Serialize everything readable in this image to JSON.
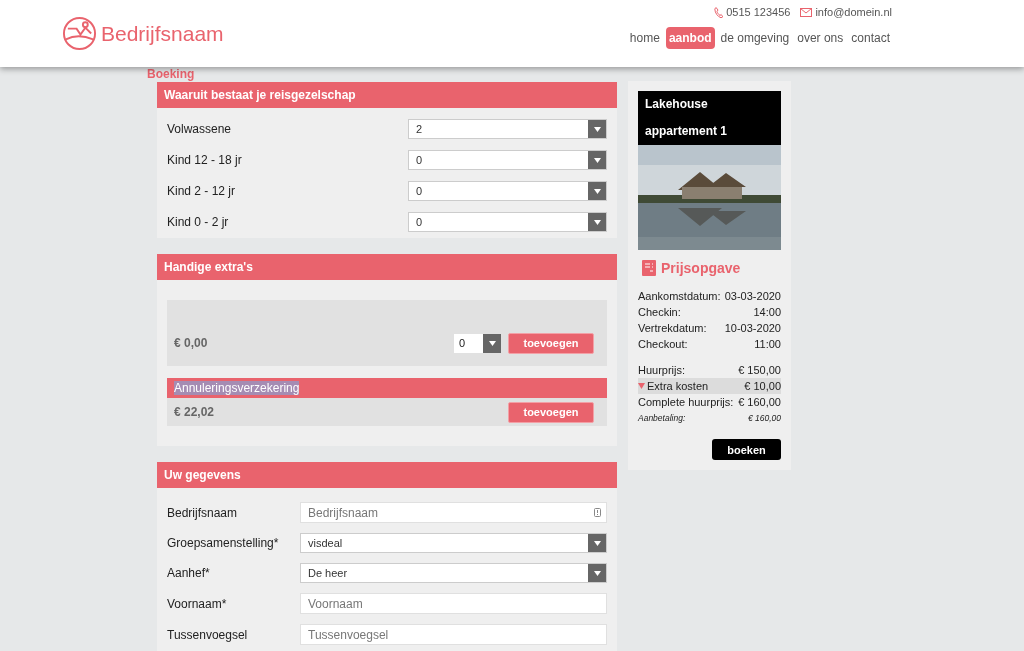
{
  "header": {
    "logo": "Bedrijfsnaam",
    "phone": "0515 123456",
    "email": "info@domein.nl",
    "nav": [
      {
        "label": "home",
        "selected": false
      },
      {
        "label": "aanbod",
        "selected": true
      },
      {
        "label": "de omgeving",
        "selected": false
      },
      {
        "label": "over ons",
        "selected": false
      },
      {
        "label": "contact",
        "selected": false
      }
    ]
  },
  "page_title": "Boeking",
  "party": {
    "title": "Waaruit bestaat je reisgezelschap",
    "rows": [
      {
        "label": "Volwassene",
        "value": "2"
      },
      {
        "label": "Kind 12 - 18 jr",
        "value": "0"
      },
      {
        "label": "Kind 2 - 12 jr",
        "value": "0"
      },
      {
        "label": "Kind 0 - 2 jr",
        "value": "0"
      }
    ]
  },
  "extras": {
    "title": "Handige extra's",
    "items": [
      {
        "kind": "quantity",
        "price": "€ 0,00",
        "quantity": "0",
        "button": "toevoegen"
      },
      {
        "kind": "simple",
        "title": "Annuleringsverzekering",
        "highlighted": true,
        "price": "€ 22,02",
        "button": "toevoegen"
      }
    ]
  },
  "details": {
    "title": "Uw gegevens",
    "fields": [
      {
        "kind": "text",
        "label": "Bedrijfsnaam",
        "placeholder": "Bedrijfsnaam"
      },
      {
        "kind": "select",
        "label": "Groepsamenstelling*",
        "value": "visdeal"
      },
      {
        "kind": "select",
        "label": "Aanhef*",
        "value": "De heer"
      },
      {
        "kind": "text",
        "label": "Voornaam*",
        "placeholder": "Voornaam"
      },
      {
        "kind": "text",
        "label": "Tussenvoegsel",
        "placeholder": "Tussenvoegsel"
      }
    ]
  },
  "quote": {
    "accommodation": "Lakehouse appartement 1",
    "title": "Prijsopgave",
    "details": [
      {
        "label": "Aankomstdatum:",
        "value": "03-03-2020"
      },
      {
        "label": "Checkin:",
        "value": "14:00"
      },
      {
        "label": "Vertrekdatum:",
        "value": "10-03-2020"
      },
      {
        "label": "Checkout:",
        "value": "11:00"
      }
    ],
    "prices": [
      {
        "kind": "normal",
        "label": "Huurprijs:",
        "value": "€ 150,00"
      },
      {
        "kind": "expandable",
        "label": "Extra kosten",
        "value": "€ 10,00"
      },
      {
        "kind": "normal",
        "label": "Complete huurprijs:",
        "value": "€ 160,00"
      },
      {
        "kind": "note",
        "label": "Aanbetaling:",
        "value": "€ 160,00"
      }
    ],
    "button": "boeken"
  }
}
